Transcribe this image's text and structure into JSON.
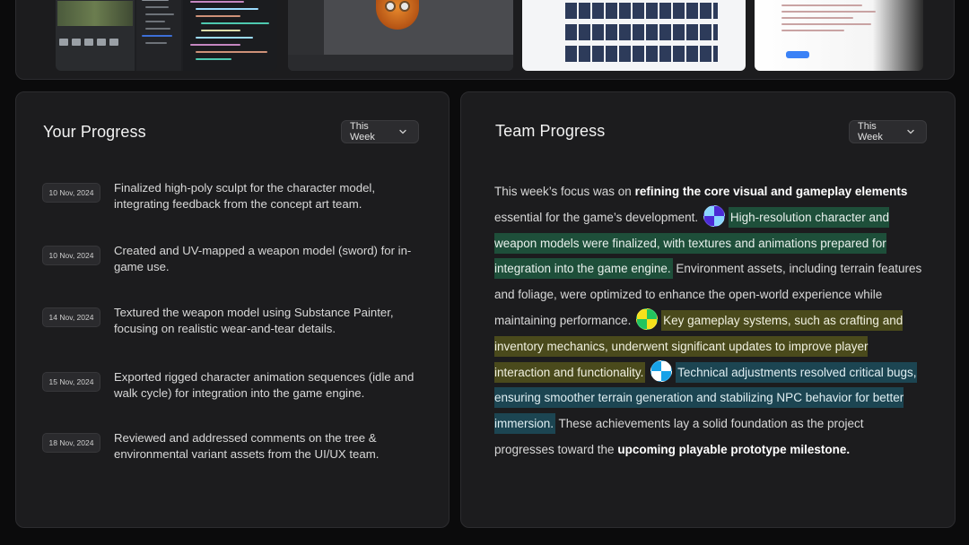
{
  "your_progress": {
    "title": "Your Progress",
    "filter": "This Week",
    "entries": [
      {
        "date": "10 Nov, 2024",
        "text": "Finalized high-poly sculpt for the character model, integrating feedback from the concept art team."
      },
      {
        "date": "10 Nov, 2024",
        "text": "Created and UV-mapped a weapon model (sword) for in-game use."
      },
      {
        "date": "14 Nov, 2024",
        "text": "Textured the weapon model using Substance Painter, focusing on realistic wear-and-tear details."
      },
      {
        "date": "15 Nov, 2024",
        "text": "Exported rigged character animation sequences (idle and walk cycle) for integration into the game engine."
      },
      {
        "date": "18 Nov, 2024",
        "text": "Reviewed and addressed comments on the tree & environmental variant assets from the UI/UX team."
      }
    ]
  },
  "team_progress": {
    "title": "Team Progress",
    "filter": "This Week",
    "p1": "This week’s focus was on ",
    "p1_bold": "refining the core visual and gameplay elements",
    "p2": " essential for the game’s development. ",
    "hl1": "High-resolution character and weapon models were finalized, with textures and animations prepared for integration into the game engine.",
    "p3": " Environment assets, including terrain features and foliage, were optimized to enhance the open-world experience while maintaining performance. ",
    "hl2": "Key gameplay systems, such as crafting and inventory mechanics, underwent significant updates to improve player interaction and functionality.",
    "p4": " ",
    "hl3": "Technical adjustments resolved critical bugs, ensuring smoother terrain generation and stabilizing NPC behavior for better immersion.",
    "p5": " These achievements lay a solid foundation as the project progresses toward the ",
    "p5_bold": "upcoming playable prototype milestone."
  }
}
